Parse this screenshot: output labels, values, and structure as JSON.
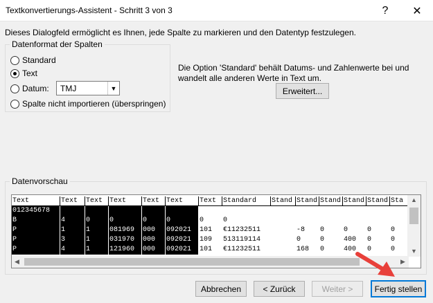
{
  "window": {
    "title": "Textkonvertierungs-Assistent - Schritt 3 von 3",
    "help_glyph": "?",
    "close_glyph": "✕"
  },
  "description": "Dieses Dialogfeld ermöglicht es Ihnen, jede Spalte zu markieren und den Datentyp festzulegen.",
  "format_group": {
    "label": "Datenformat der Spalten",
    "options": [
      {
        "label": "Standard",
        "selected": false
      },
      {
        "label": "Text",
        "selected": true
      },
      {
        "label": "Datum:",
        "selected": false
      },
      {
        "label": "Spalte nicht importieren (überspringen)",
        "selected": false
      }
    ],
    "date_format": "TMJ"
  },
  "info_text": "Die Option 'Standard' behält Datums- und Zahlenwerte bei und wandelt alle anderen Werte in Text um.",
  "advanced_button": "Erweitert...",
  "preview": {
    "label": "Datenvorschau",
    "header": [
      "Text",
      "Text",
      "Text",
      "Text",
      "Text",
      "Text",
      "Text",
      "Standard",
      "Stand",
      "Stand",
      "Stand",
      "Stand",
      "Stand",
      "Sta"
    ],
    "rows": [
      [
        "012345678",
        "",
        "",
        "",
        "",
        "",
        "",
        "",
        "",
        "",
        "",
        "",
        "",
        ""
      ],
      [
        "B",
        "4",
        "0",
        "0",
        "0",
        "0",
        "0",
        "0",
        "",
        "",
        "",
        "",
        "",
        ""
      ],
      [
        "P",
        "1",
        "1",
        "081969",
        "000",
        "092021",
        "101",
        "€11232511",
        "",
        "-8",
        "0",
        "0",
        "0",
        "0"
      ],
      [
        "P",
        "3",
        "1",
        "031970",
        "000",
        "092021",
        "109",
        "513119114",
        "",
        "0",
        "0",
        "400",
        "0",
        "0"
      ],
      [
        "P",
        "4",
        "1",
        "121960",
        "000",
        "092021",
        "101",
        "€11232511",
        "",
        "168",
        "0",
        "400",
        "0",
        "0"
      ]
    ]
  },
  "buttons": {
    "cancel": "Abbrechen",
    "back": "< Zurück",
    "next": "Weiter >",
    "finish": "Fertig stellen"
  },
  "colors": {
    "accent": "#0078d7",
    "arrow": "#e8403a",
    "selection": "#000000"
  }
}
